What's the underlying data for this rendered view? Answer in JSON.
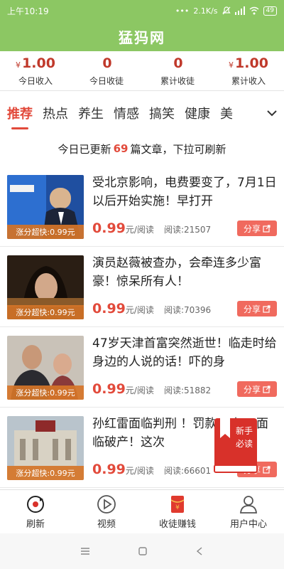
{
  "status": {
    "time": "上午10:19",
    "speed": "2.1K/s",
    "battery": "49"
  },
  "app": {
    "title": "猛犸网"
  },
  "stats": [
    {
      "currency": "¥",
      "value": "1.00",
      "label": "今日收入"
    },
    {
      "currency": "",
      "value": "0",
      "label": "今日收徒"
    },
    {
      "currency": "",
      "value": "0",
      "label": "累计收徒"
    },
    {
      "currency": "¥",
      "value": "1.00",
      "label": "累计收入"
    }
  ],
  "tabs": [
    "推荐",
    "热点",
    "养生",
    "情感",
    "搞笑",
    "健康",
    "美"
  ],
  "notice": {
    "prefix": "今日已更新",
    "count": "69",
    "suffix": "篇文章，下拉可刷新"
  },
  "articles": [
    {
      "title": "受北京影响，电费要变了，7月1日以后开始实施！早打开",
      "badge": "涨分超快:0.99元",
      "price": "0.99",
      "unit": "元/阅读",
      "reads": "阅读:21507",
      "share": "分享"
    },
    {
      "title": "演员赵薇被查办，会牵连多少富豪！惊呆所有人！",
      "badge": "涨分超快:0.99元",
      "price": "0.99",
      "unit": "元/阅读",
      "reads": "阅读:70396",
      "share": "分享"
    },
    {
      "title": "47岁天津首富突然逝世！临走时给身边的人说的话！吓的身",
      "badge": "涨分超快:0.99元",
      "price": "0.99",
      "unit": "元/阅读",
      "reads": "阅读:51882",
      "share": "分享"
    },
    {
      "title": "孙红雷面临判刑 ！罚款20亿，面临破产！这次",
      "badge": "涨分超快:0.99元",
      "price": "0.99",
      "unit": "元/阅读",
      "reads": "阅读:66601",
      "share": "分享"
    }
  ],
  "float_book": {
    "line1": "新手",
    "line2": "必读"
  },
  "bottom_nav": [
    {
      "label": "刷新",
      "icon": "refresh-icon"
    },
    {
      "label": "视频",
      "icon": "play-icon"
    },
    {
      "label": "收徒赚钱",
      "icon": "red-envelope-icon"
    },
    {
      "label": "用户中心",
      "icon": "user-icon"
    }
  ],
  "colors": {
    "brand_green": "#8cc763",
    "accent_red": "#e24a3b",
    "badge_orange": "#d67528"
  }
}
